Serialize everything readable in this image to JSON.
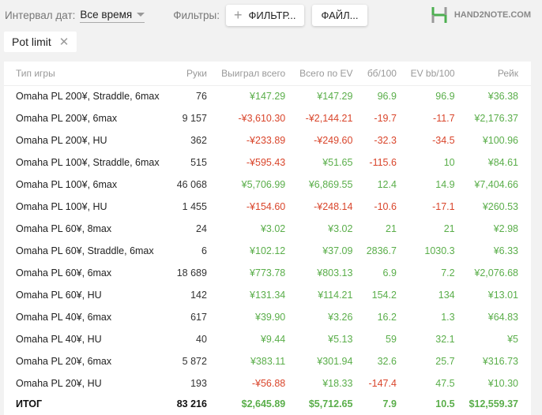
{
  "toolbar": {
    "interval_label": "Интервал дат:",
    "interval_value": "Все время",
    "filters_label": "Фильтры:",
    "filter_button": "ФИЛЬТР...",
    "file_button": "ФАЙЛ...",
    "logo": "HAND2NOTE.COM"
  },
  "chip": {
    "label": "Pot limit"
  },
  "table": {
    "headers": [
      "Тип игры",
      "Руки",
      "Выиграл всего",
      "Всего по EV",
      "бб/100",
      "EV bb/100",
      "Рейк"
    ],
    "rows": [
      [
        "Omaha PL 200¥, Straddle, 6max",
        "76",
        "¥147.29",
        "¥147.29",
        "96.9",
        "96.9",
        "¥36.38"
      ],
      [
        "Omaha PL 200¥, 6max",
        "9 157",
        "-¥3,610.30",
        "-¥2,144.21",
        "-19.7",
        "-11.7",
        "¥2,176.37"
      ],
      [
        "Omaha PL 200¥, HU",
        "362",
        "-¥233.89",
        "-¥249.60",
        "-32.3",
        "-34.5",
        "¥100.96"
      ],
      [
        "Omaha PL 100¥, Straddle, 6max",
        "515",
        "-¥595.43",
        "¥51.65",
        "-115.6",
        "10",
        "¥84.61"
      ],
      [
        "Omaha PL 100¥, 6max",
        "46 068",
        "¥5,706.99",
        "¥6,869.55",
        "12.4",
        "14.9",
        "¥7,404.66"
      ],
      [
        "Omaha PL 100¥, HU",
        "1 455",
        "-¥154.60",
        "-¥248.14",
        "-10.6",
        "-17.1",
        "¥260.53"
      ],
      [
        "Omaha PL 60¥, 8max",
        "24",
        "¥3.02",
        "¥3.02",
        "21",
        "21",
        "¥2.98"
      ],
      [
        "Omaha PL 60¥, Straddle, 6max",
        "6",
        "¥102.12",
        "¥37.09",
        "2836.7",
        "1030.3",
        "¥6.33"
      ],
      [
        "Omaha PL 60¥, 6max",
        "18 689",
        "¥773.78",
        "¥803.13",
        "6.9",
        "7.2",
        "¥2,076.68"
      ],
      [
        "Omaha PL 60¥, HU",
        "142",
        "¥131.34",
        "¥114.21",
        "154.2",
        "134",
        "¥13.01"
      ],
      [
        "Omaha PL 40¥, 6max",
        "617",
        "¥39.90",
        "¥3.26",
        "16.2",
        "1.3",
        "¥64.83"
      ],
      [
        "Omaha PL 40¥, HU",
        "40",
        "¥9.44",
        "¥5.13",
        "59",
        "32.1",
        "¥5"
      ],
      [
        "Omaha PL 20¥, 6max",
        "5 872",
        "¥383.11",
        "¥301.94",
        "32.6",
        "25.7",
        "¥316.73"
      ],
      [
        "Omaha PL 20¥, HU",
        "193",
        "-¥56.88",
        "¥18.33",
        "-147.4",
        "47.5",
        "¥10.30"
      ]
    ],
    "total": [
      "ИТОГ",
      "83 216",
      "$2,645.89",
      "$5,712.65",
      "7.9",
      "10.5",
      "$12,559.37"
    ]
  }
}
